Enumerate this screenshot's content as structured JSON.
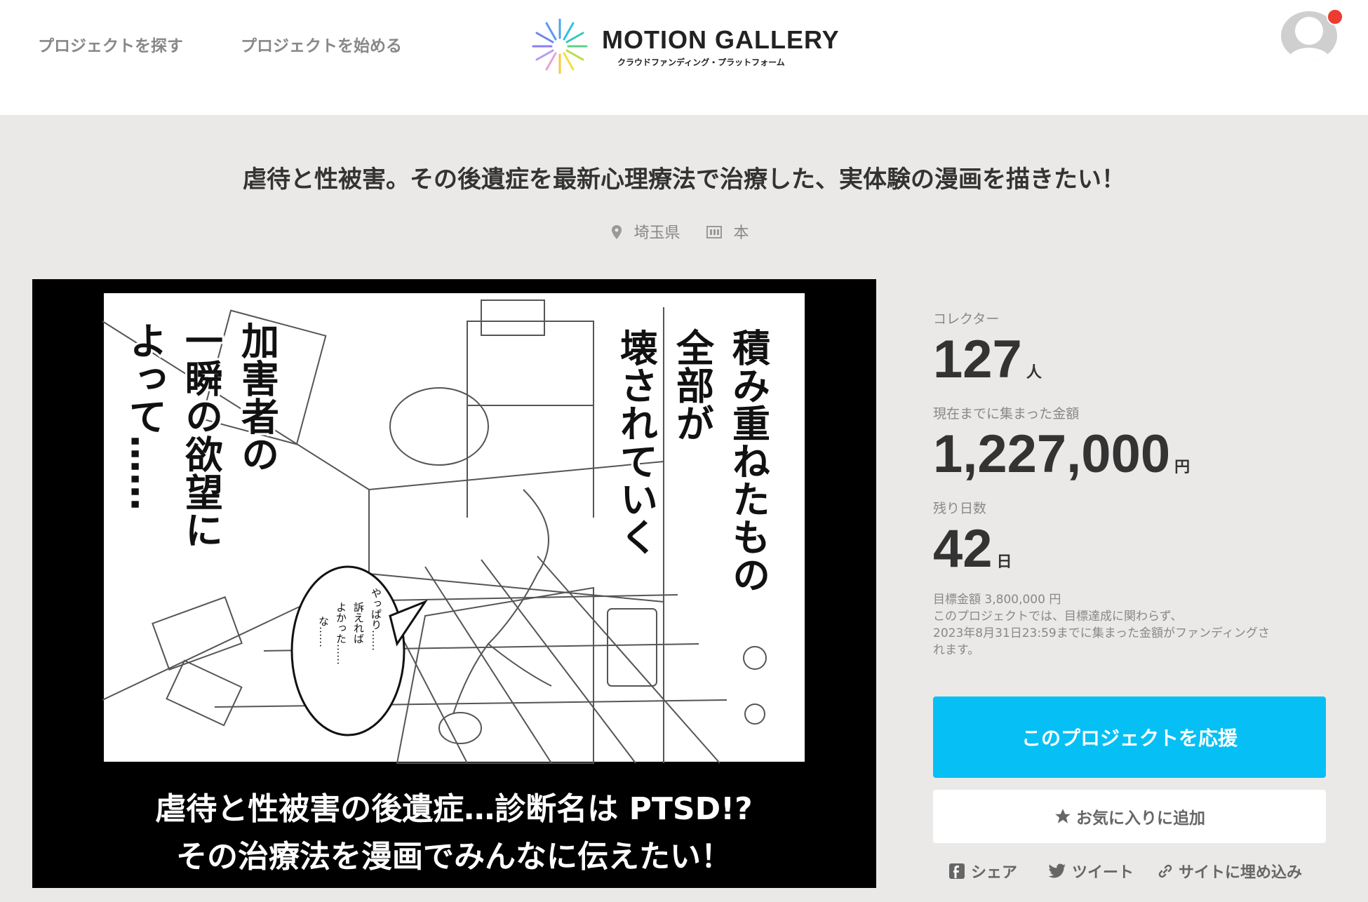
{
  "header": {
    "nav": [
      "プロジェクトを探す",
      "プロジェクトを始める"
    ],
    "logo_title": "MOTION GALLERY",
    "logo_sub": "クラウドファンディング・プラットフォーム"
  },
  "project": {
    "title": "虐待と性被害。その後遺症を最新心理療法で治療した、実体験の漫画を描きたい！",
    "location": "埼玉県",
    "category": "本"
  },
  "hero": {
    "vertical_text": [
      "積み重ねたもの",
      "全部が",
      "壊されていく",
      "加害者の",
      "一瞬の欲望に",
      "よって……"
    ],
    "bubble_text": [
      "やっぱり……",
      "訴えれば",
      "よかった……",
      "な……"
    ],
    "caption_lines": [
      "虐待と性被害の後遺症…診断名は PTSD!?",
      "その治療法を漫画でみんなに伝えたい！"
    ]
  },
  "stats": {
    "collectors_label": "コレクター",
    "collectors": "127",
    "collectors_unit": "人",
    "amount_label": "現在までに集まった金額",
    "amount": "1,227,000",
    "amount_unit": "円",
    "days_label": "残り日数",
    "days": "42",
    "days_unit": "日",
    "goal": "目標金額 3,800,000 円",
    "note_line1": "このプロジェクトでは、目標達成に関わらず、",
    "note_line2": "2023年8月31日23:59までに集まった金額がファンディングさ",
    "note_line3": "れます。"
  },
  "actions": {
    "support": "このプロジェクトを応援",
    "favorite": "お気に入りに追加",
    "share": "シェア",
    "tweet": "ツイート",
    "embed": "サイトに埋め込み"
  },
  "colors": {
    "accent": "#06c0f5",
    "notification": "#ee3b2f",
    "background": "#ebe9e7"
  }
}
